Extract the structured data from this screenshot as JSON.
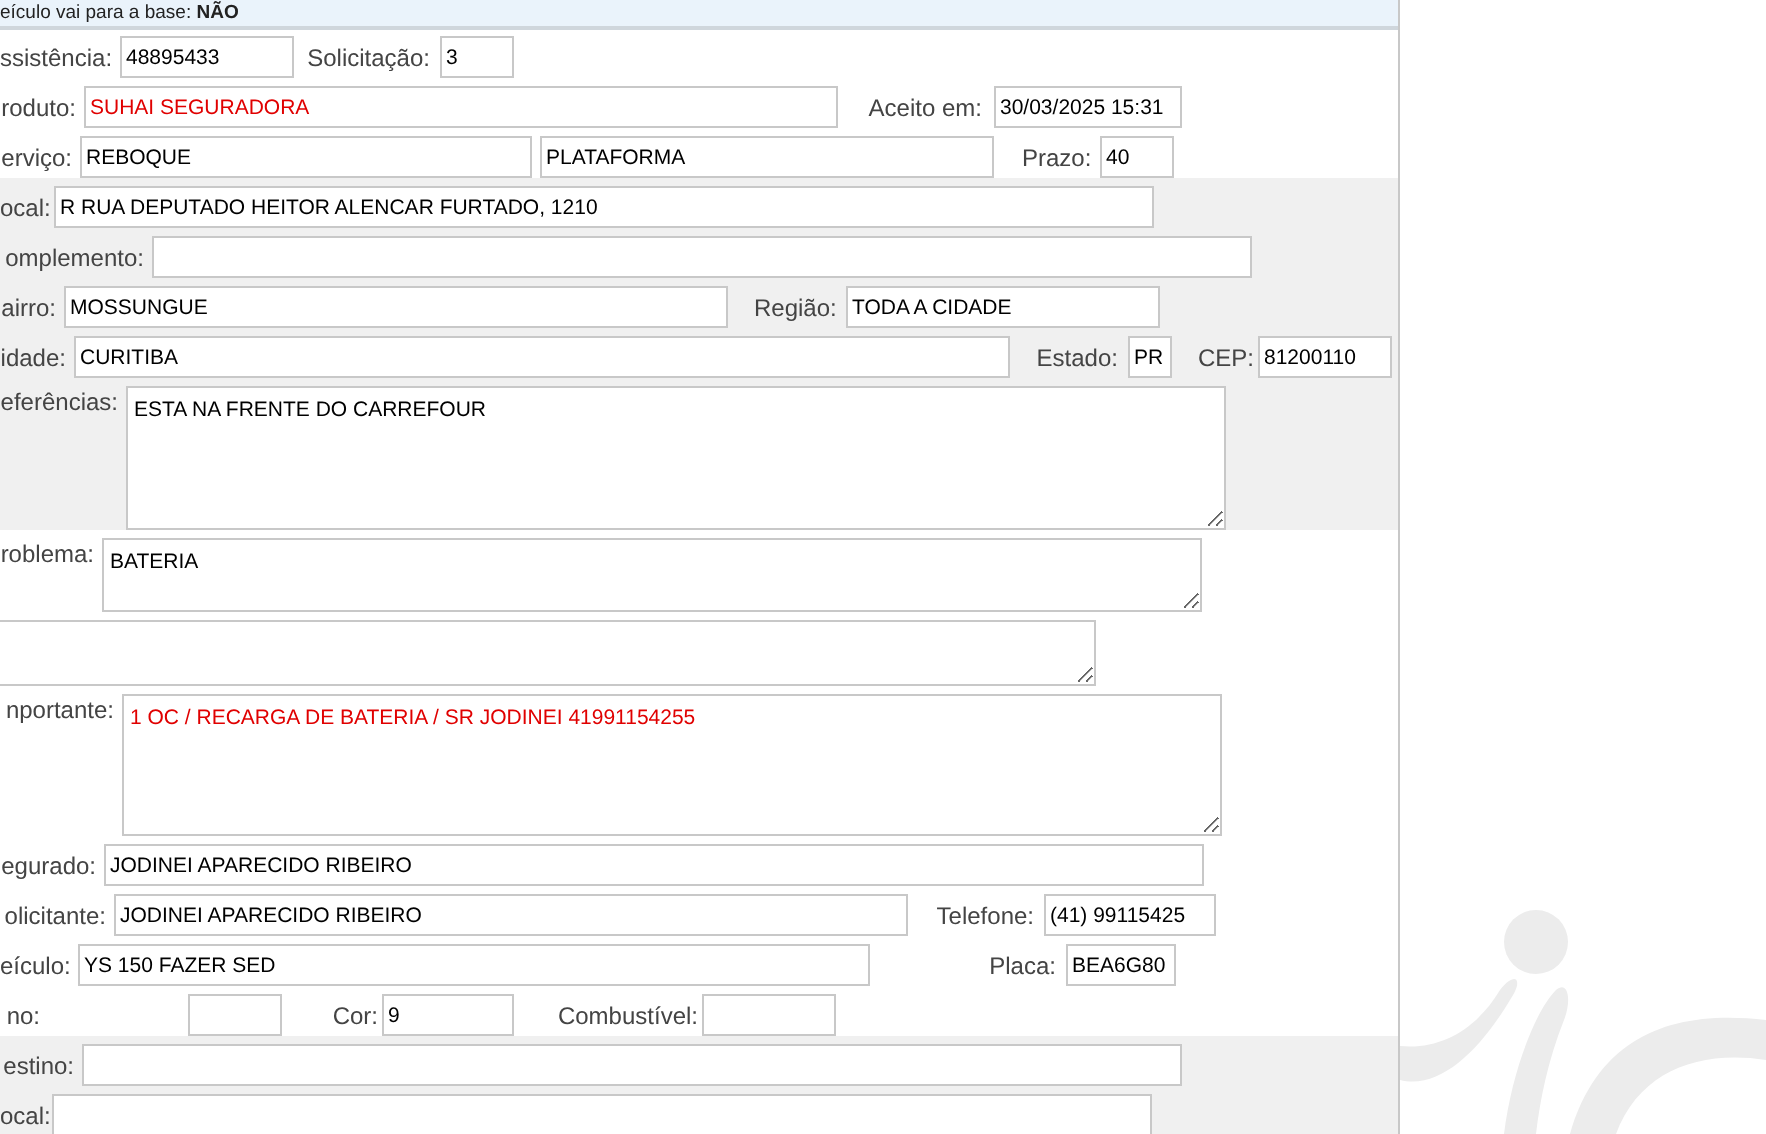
{
  "notice": "eículo vai para a base: **NÃO**",
  "sections": [
    {
      "shaded": false,
      "rows": [
        {
          "items": [
            {
              "kind": "label",
              "text": "ssistência:"
            },
            {
              "kind": "input",
              "value": "48895433",
              "alert": false
            },
            {
              "kind": "label",
              "text": "Solicitação:"
            },
            {
              "kind": "input",
              "value": "3",
              "alert": false
            }
          ]
        },
        {
          "items": [
            {
              "kind": "label",
              "text": "roduto:"
            },
            {
              "kind": "input",
              "value": "SUHAI SEGURADORA",
              "alert": true
            },
            {
              "kind": "label",
              "text": "Aceito em:"
            },
            {
              "kind": "input",
              "value": "30/03/2025 15:31",
              "alert": false
            }
          ]
        },
        {
          "items": [
            {
              "kind": "label",
              "text": "erviço:"
            },
            {
              "kind": "input",
              "value": "REBOQUE",
              "alert": false
            },
            {
              "kind": "input",
              "value": "PLATAFORMA",
              "alert": false
            },
            {
              "kind": "label",
              "text": "Prazo:"
            },
            {
              "kind": "input",
              "value": "40",
              "alert": false
            }
          ]
        }
      ]
    },
    {
      "shaded": true,
      "rows": [
        {
          "items": [
            {
              "kind": "label",
              "text": "ocal:"
            },
            {
              "kind": "input",
              "value": "R RUA DEPUTADO HEITOR ALENCAR FURTADO, 1210",
              "alert": false
            }
          ]
        },
        {
          "items": [
            {
              "kind": "label",
              "text": "omplemento:"
            },
            {
              "kind": "input"
            }
          ]
        },
        {
          "items": [
            {
              "kind": "label",
              "text": "airro:"
            },
            {
              "kind": "input",
              "value": "MOSSUNGUE",
              "alert": false
            },
            {
              "kind": "label",
              "text": "Região:"
            },
            {
              "kind": "input",
              "value": "TODA A CIDADE",
              "alert": false
            }
          ]
        },
        {
          "items": [
            {
              "kind": "label",
              "text": "idade:"
            },
            {
              "kind": "input",
              "value": "CURITIBA",
              "alert": false
            },
            {
              "kind": "label",
              "text": "Estado:"
            },
            {
              "kind": "input",
              "value": "PR",
              "alert": false
            },
            {
              "kind": "label",
              "text": "CEP:"
            },
            {
              "kind": "input",
              "value": "81200110",
              "alert": false
            }
          ]
        },
        {
          "items": [
            {
              "kind": "label",
              "text": "eferências:"
            },
            {
              "kind": "textarea",
              "value": "ESTA NA FRENTE DO CARREFOUR",
              "alert": false
            }
          ]
        }
      ]
    },
    {
      "shaded": false,
      "rows": [
        {
          "items": [
            {
              "kind": "label",
              "text": "roblema:"
            },
            {
              "kind": "textarea",
              "value": "BATERIA",
              "alert": false
            }
          ]
        },
        {
          "items": [
            {
              "kind": "textarea"
            }
          ]
        },
        {
          "items": [
            {
              "kind": "label",
              "text": "nportante:"
            },
            {
              "kind": "textarea",
              "value": "1 OC / RECARGA DE BATERIA / SR JODINEI 41991154255",
              "alert": true
            }
          ]
        },
        {
          "items": [
            {
              "kind": "label",
              "text": "egurado:"
            },
            {
              "kind": "input",
              "value": "JODINEI APARECIDO RIBEIRO",
              "alert": false
            }
          ]
        },
        {
          "items": [
            {
              "kind": "label",
              "text": "olicitante:"
            },
            {
              "kind": "input",
              "value": "JODINEI APARECIDO RIBEIRO",
              "alert": false
            },
            {
              "kind": "label",
              "text": "Telefone:"
            },
            {
              "kind": "input",
              "value": "(41) 99115425",
              "alert": false
            }
          ]
        },
        {
          "items": [
            {
              "kind": "label",
              "text": "eículo:"
            },
            {
              "kind": "input",
              "value": "YS 150 FAZER SED",
              "alert": false
            },
            {
              "kind": "label",
              "text": "Placa:"
            },
            {
              "kind": "input",
              "value": "BEA6G80",
              "alert": false
            }
          ]
        },
        {
          "items": [
            {
              "kind": "label",
              "text": "no:"
            },
            {
              "kind": "input"
            },
            {
              "kind": "label",
              "text": "Cor:"
            },
            {
              "kind": "input",
              "value": "9",
              "alert": false
            },
            {
              "kind": "label",
              "text": "Combustível:"
            },
            {
              "kind": "input"
            }
          ]
        }
      ]
    },
    {
      "shaded": true,
      "rows": [
        {
          "items": [
            {
              "kind": "label",
              "text": "estino:"
            },
            {
              "kind": "input"
            }
          ]
        },
        {
          "items": [
            {
              "kind": "label",
              "text": "ocal:"
            },
            {
              "kind": "input"
            }
          ]
        }
      ]
    }
  ]
}
